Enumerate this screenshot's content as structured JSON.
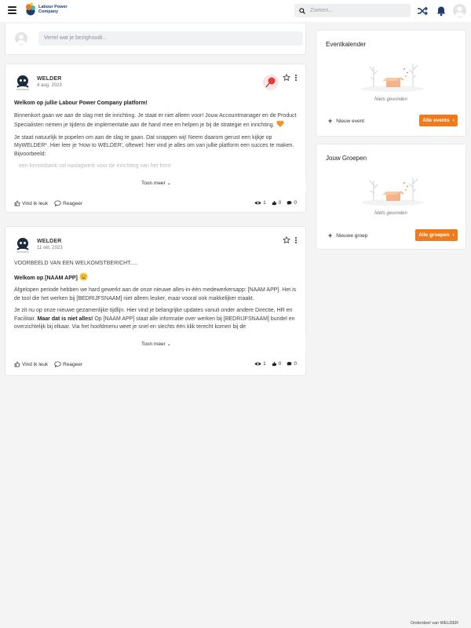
{
  "header": {
    "logo_text": "Labour Power Company",
    "search_placeholder": "Zoeken..."
  },
  "composer": {
    "placeholder": "Vertel wat je bezighoudt..."
  },
  "posts": [
    {
      "author": "WELDER",
      "date": "4 aug. 2023",
      "title": "Welkom op jullie Labour Power Company platform!",
      "p1": "Binnenkort gaan we aan de slag met de inrichting. Je staat er niet alleen voor! Jouw Accountmanager en de Product Specialisten nemen je tijdens de implementatie aan de hand mee en helpen je bij de strategie en inrichting.",
      "p2": "Je staat natuurlijk te popelen om aan de slag te gaan. Dat snappen wij! Neem daarom gerust een kijkje op MyWELDER*. Hier leer je 'How to WELDER', oftewel: hier vind je alles om van jullie platform een succes te maken. Bijvoorbeeld:",
      "p3": "een kennisbank vol naslagwerk voor de inrichting van het front",
      "more_label": "Toon meer",
      "like_label": "Vind ik leuk",
      "reply_label": "Reageer",
      "views": "1",
      "likes": "0",
      "comments": "0"
    },
    {
      "author": "WELDER",
      "date": "11 okt. 2023",
      "intro": "VOORBEELD VAN EEN WELKOMSTBERICHT.....",
      "title": "Welkom op [NAAM APP]",
      "p1": "Afgelopen periode hebben we hard gewerkt aan de onze nieuwe alles-in-één medewerkersapp: [NAAM APP]. Het is de tool die het werken bij [BEDRIJFSNAAM] niet alleen leuker, maar vooral ook makkelijker maakt.",
      "p2a": "Je zit nu op onze nieuwe gezamenlijke tijdlijn. Hier vind je belangrijke updates vanuit onder andere Directie, HR en Facilitair. ",
      "p2b": "Maar dat is niet alles!",
      "p2c": " Op [NAAM APP] staat alle informatie over werken bij [BEDRIJFSNAAM] bundel en overzichtelijk bij elkaar. Via het hoofdmenu weet je snel en slechts één klik terecht komen bij de",
      "more_label": "Toon meer",
      "like_label": "Vind ik leuk",
      "reply_label": "Reageer",
      "views": "1",
      "likes": "0",
      "comments": "0"
    }
  ],
  "sidebar": {
    "events": {
      "title": "Eventkalender",
      "empty": "Niets gevonden",
      "new_label": "Nieuw event",
      "all_label": "Alle events"
    },
    "groups": {
      "title": "Jouw Groepen",
      "empty": "Niets gevonden",
      "new_label": "Nieuwe groep",
      "all_label": "Alle groepen"
    }
  },
  "footer": {
    "text": "Onderdeel van WELDER"
  },
  "colors": {
    "accent": "#f07b1c",
    "navy": "#1c3c6e",
    "background": "#f4f4f5"
  }
}
